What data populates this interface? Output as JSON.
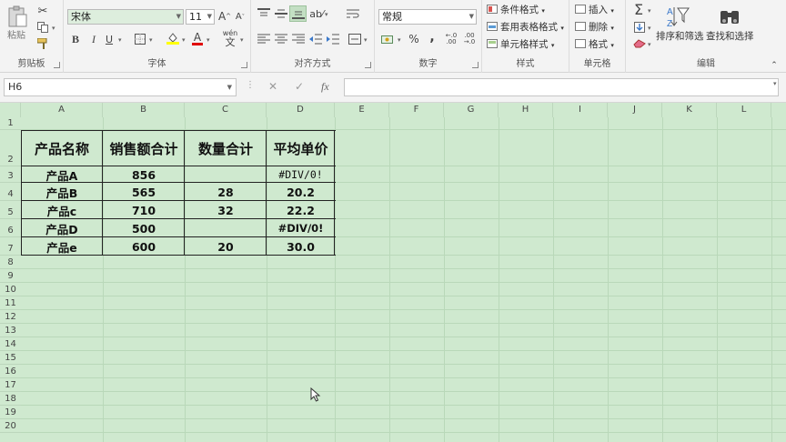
{
  "ribbon": {
    "clipboard": {
      "paste_label": "粘贴",
      "group_label": "剪贴板"
    },
    "font": {
      "font_name": "宋体",
      "font_size": "11",
      "bold": "B",
      "italic": "I",
      "underline": "U",
      "font_color_glyph": "A",
      "grow_glyph": "A",
      "shrink_glyph": "A",
      "phonetic_glyph": "wén",
      "group_label": "字体"
    },
    "alignment": {
      "group_label": "对齐方式"
    },
    "number": {
      "format": "常规",
      "percent": "%",
      "comma": ",",
      "group_label": "数字"
    },
    "styles": {
      "conditional": "条件格式",
      "table": "套用表格格式",
      "cell_styles": "单元格样式",
      "group_label": "样式"
    },
    "cells": {
      "insert": "插入",
      "delete": "删除",
      "format": "格式",
      "group_label": "单元格"
    },
    "editing": {
      "sum_glyph": "Σ",
      "sort_filter": "排序和筛选",
      "find_select": "查找和选择",
      "group_label": "编辑"
    }
  },
  "formula_bar": {
    "name_box": "H6",
    "fx": "fx",
    "cancel": "✕",
    "enter": "✓",
    "formula": ""
  },
  "columns": [
    "A",
    "B",
    "C",
    "D",
    "E",
    "F",
    "G",
    "H",
    "I",
    "J",
    "K",
    "L"
  ],
  "rows": [
    "1",
    "2",
    "3",
    "4",
    "5",
    "6",
    "7",
    "8",
    "9",
    "10",
    "11",
    "12",
    "13",
    "14",
    "15",
    "16",
    "17",
    "18",
    "19",
    "20"
  ],
  "table": {
    "headers": [
      "产品名称",
      "销售额合计",
      "数量合计",
      "平均单价"
    ],
    "rows": [
      [
        "产品A",
        "856",
        "",
        "#DIV/0!"
      ],
      [
        "产品B",
        "565",
        "28",
        "20.2"
      ],
      [
        "产品c",
        "710",
        "32",
        "22.2"
      ],
      [
        "产品D",
        "500",
        "",
        "#DIV/0!"
      ],
      [
        "产品e",
        "600",
        "20",
        "30.0"
      ]
    ]
  }
}
